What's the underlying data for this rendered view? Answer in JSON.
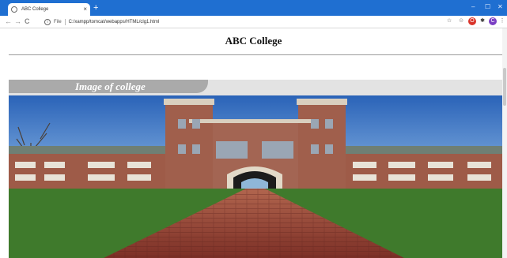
{
  "browser": {
    "tab_title": "ABC College",
    "tab_close": "×",
    "new_tab": "+",
    "minimize": "–",
    "restore": "☐",
    "close": "✕",
    "back": "←",
    "forward": "→",
    "reload": "C",
    "home_icon": "home-icon",
    "url_scheme": "File",
    "url": "C:/xampp/tomcat/webapps/HTML/clg1.html",
    "star": "☆",
    "ext_a": "⊝",
    "ext_b": "O",
    "ext_c": "✱",
    "ext_d": "C",
    "menu": "⋮",
    "accent": "#1f6fd1"
  },
  "page": {
    "title": "ABC College",
    "section_heading": "Image of college",
    "image_alt": "college-building-photo"
  }
}
